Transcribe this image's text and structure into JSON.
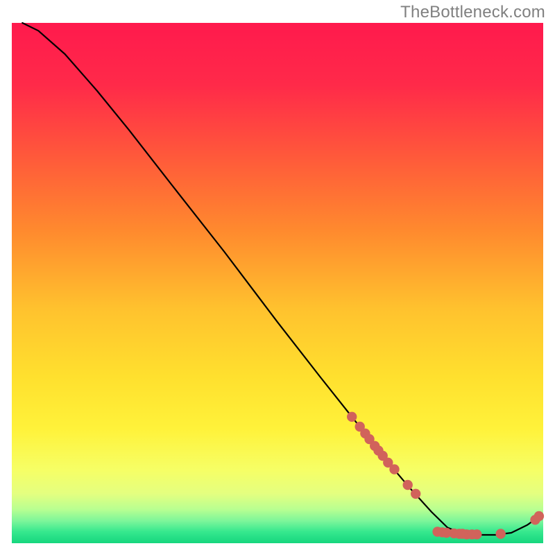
{
  "watermark": "TheBottleneck.com",
  "chart_data": {
    "type": "line",
    "title": "",
    "xlabel": "",
    "ylabel": "",
    "xlim": [
      0,
      100
    ],
    "ylim": [
      0,
      100
    ],
    "background_gradient": {
      "top": "#ff1a4d",
      "mid_upper": "#ff6a33",
      "mid": "#ffd633",
      "mid_lower": "#f9ff66",
      "low_green_start": "#c8ff99",
      "bottom": "#1fe08a"
    },
    "series": [
      {
        "name": "curve",
        "color": "#000000",
        "style": "line",
        "points": [
          {
            "x": 2.0,
            "y": 100.0
          },
          {
            "x": 5.0,
            "y": 98.5
          },
          {
            "x": 10.0,
            "y": 94.0
          },
          {
            "x": 16.0,
            "y": 87.0
          },
          {
            "x": 22.0,
            "y": 79.5
          },
          {
            "x": 30.0,
            "y": 69.0
          },
          {
            "x": 40.0,
            "y": 56.0
          },
          {
            "x": 50.0,
            "y": 42.5
          },
          {
            "x": 58.0,
            "y": 32.0
          },
          {
            "x": 65.0,
            "y": 23.0
          },
          {
            "x": 70.0,
            "y": 16.5
          },
          {
            "x": 75.0,
            "y": 10.5
          },
          {
            "x": 79.0,
            "y": 6.0
          },
          {
            "x": 82.0,
            "y": 3.0
          },
          {
            "x": 85.0,
            "y": 1.8
          },
          {
            "x": 88.0,
            "y": 1.6
          },
          {
            "x": 91.0,
            "y": 1.6
          },
          {
            "x": 94.0,
            "y": 2.0
          },
          {
            "x": 97.0,
            "y": 3.5
          },
          {
            "x": 99.0,
            "y": 5.0
          }
        ]
      },
      {
        "name": "markers",
        "color": "#d1635b",
        "style": "points",
        "points": [
          {
            "x": 64.0,
            "y": 24.3
          },
          {
            "x": 65.5,
            "y": 22.4
          },
          {
            "x": 66.5,
            "y": 21.1
          },
          {
            "x": 67.3,
            "y": 20.0
          },
          {
            "x": 68.3,
            "y": 18.7
          },
          {
            "x": 69.0,
            "y": 17.8
          },
          {
            "x": 69.8,
            "y": 16.8
          },
          {
            "x": 70.8,
            "y": 15.5
          },
          {
            "x": 72.0,
            "y": 14.2
          },
          {
            "x": 74.5,
            "y": 11.2
          },
          {
            "x": 76.0,
            "y": 9.5
          },
          {
            "x": 80.1,
            "y": 2.2
          },
          {
            "x": 81.0,
            "y": 2.1
          },
          {
            "x": 81.8,
            "y": 2.0
          },
          {
            "x": 83.2,
            "y": 1.9
          },
          {
            "x": 84.2,
            "y": 1.8
          },
          {
            "x": 84.8,
            "y": 1.8
          },
          {
            "x": 85.6,
            "y": 1.7
          },
          {
            "x": 86.6,
            "y": 1.7
          },
          {
            "x": 87.5,
            "y": 1.7
          },
          {
            "x": 92.0,
            "y": 1.8
          },
          {
            "x": 98.5,
            "y": 4.5
          },
          {
            "x": 99.2,
            "y": 5.2
          }
        ]
      }
    ]
  }
}
